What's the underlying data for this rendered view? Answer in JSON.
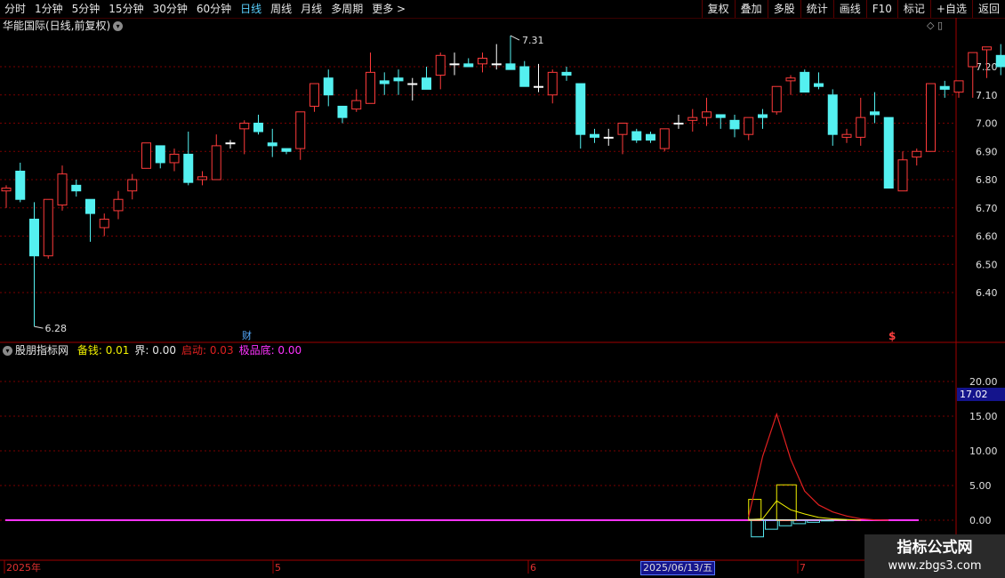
{
  "toolbar": {
    "left": [
      "分时",
      "1分钟",
      "5分钟",
      "15分钟",
      "30分钟",
      "60分钟",
      "日线",
      "周线",
      "月线",
      "多周期",
      "更多 >"
    ],
    "active_index": 6,
    "right": [
      "复权",
      "叠加",
      "多股",
      "统计",
      "画线",
      "F10",
      "标记",
      "+自选",
      "返回"
    ]
  },
  "stock": {
    "title": "华能国际(日线,前复权)"
  },
  "top_icons": "◇ ▯",
  "price_axis": {
    "labels": [
      "7.20",
      "7.10",
      "7.00",
      "6.90",
      "6.80",
      "6.70",
      "6.60",
      "6.50",
      "6.40"
    ],
    "values": [
      7.2,
      7.1,
      7.0,
      6.9,
      6.8,
      6.7,
      6.6,
      6.5,
      6.4
    ]
  },
  "annotations": {
    "high": "7.31",
    "low": "6.28",
    "cai": "财",
    "dollar": "$"
  },
  "candles": [
    [
      6.76,
      6.78,
      6.7,
      6.77
    ],
    [
      6.83,
      6.86,
      6.72,
      6.73
    ],
    [
      6.66,
      6.72,
      6.28,
      6.53
    ],
    [
      6.53,
      6.73,
      6.52,
      6.73
    ],
    [
      6.71,
      6.85,
      6.69,
      6.82
    ],
    [
      6.78,
      6.8,
      6.74,
      6.76
    ],
    [
      6.73,
      6.73,
      6.58,
      6.68
    ],
    [
      6.63,
      6.68,
      6.6,
      6.66
    ],
    [
      6.69,
      6.76,
      6.66,
      6.73
    ],
    [
      6.76,
      6.82,
      6.73,
      6.8
    ],
    [
      6.84,
      6.93,
      6.84,
      6.93
    ],
    [
      6.92,
      6.92,
      6.84,
      6.86
    ],
    [
      6.86,
      6.91,
      6.83,
      6.89
    ],
    [
      6.89,
      6.97,
      6.78,
      6.79
    ],
    [
      6.8,
      6.83,
      6.78,
      6.81
    ],
    [
      6.8,
      6.96,
      6.8,
      6.92
    ],
    [
      6.93,
      6.94,
      6.91,
      6.93
    ],
    [
      6.98,
      7.01,
      6.89,
      7.0
    ],
    [
      7.0,
      7.03,
      6.96,
      6.97
    ],
    [
      6.93,
      6.98,
      6.88,
      6.92
    ],
    [
      6.91,
      6.91,
      6.89,
      6.9
    ],
    [
      6.91,
      7.04,
      6.87,
      7.04
    ],
    [
      7.06,
      7.14,
      7.04,
      7.14
    ],
    [
      7.16,
      7.19,
      7.06,
      7.1
    ],
    [
      7.06,
      7.06,
      7.0,
      7.02
    ],
    [
      7.05,
      7.12,
      7.04,
      7.08
    ],
    [
      7.07,
      7.25,
      7.07,
      7.18
    ],
    [
      7.15,
      7.18,
      7.1,
      7.14
    ],
    [
      7.16,
      7.19,
      7.1,
      7.15
    ],
    [
      7.14,
      7.16,
      7.08,
      7.14
    ],
    [
      7.16,
      7.2,
      7.13,
      7.12
    ],
    [
      7.17,
      7.25,
      7.12,
      7.24
    ],
    [
      7.21,
      7.25,
      7.17,
      7.21
    ],
    [
      7.21,
      7.23,
      7.2,
      7.2
    ],
    [
      7.21,
      7.25,
      7.18,
      7.23
    ],
    [
      7.21,
      7.28,
      7.19,
      7.21
    ],
    [
      7.21,
      7.31,
      7.2,
      7.19
    ],
    [
      7.2,
      7.22,
      7.13,
      7.13
    ],
    [
      7.13,
      7.21,
      7.11,
      7.13
    ],
    [
      7.1,
      7.19,
      7.07,
      7.18
    ],
    [
      7.18,
      7.2,
      7.15,
      7.17
    ],
    [
      7.14,
      7.14,
      6.91,
      6.96
    ],
    [
      6.96,
      6.98,
      6.93,
      6.95
    ],
    [
      6.95,
      6.98,
      6.92,
      6.95
    ],
    [
      6.96,
      6.98,
      6.89,
      7.0
    ],
    [
      6.97,
      6.98,
      6.93,
      6.94
    ],
    [
      6.96,
      6.97,
      6.93,
      6.94
    ],
    [
      6.91,
      6.98,
      6.9,
      6.98
    ],
    [
      7.0,
      7.03,
      6.98,
      7.0
    ],
    [
      7.01,
      7.05,
      6.97,
      7.02
    ],
    [
      7.02,
      7.09,
      6.99,
      7.04
    ],
    [
      7.03,
      7.03,
      6.98,
      7.02
    ],
    [
      7.01,
      7.03,
      6.95,
      6.98
    ],
    [
      6.96,
      7.02,
      6.94,
      7.02
    ],
    [
      7.03,
      7.05,
      6.98,
      7.02
    ],
    [
      7.04,
      7.13,
      7.03,
      7.13
    ],
    [
      7.15,
      7.17,
      7.1,
      7.16
    ],
    [
      7.18,
      7.19,
      7.11,
      7.11
    ],
    [
      7.14,
      7.18,
      7.12,
      7.13
    ],
    [
      7.1,
      7.12,
      6.92,
      6.96
    ],
    [
      6.95,
      6.98,
      6.93,
      6.96
    ],
    [
      6.95,
      7.09,
      6.92,
      7.02
    ],
    [
      7.04,
      7.11,
      7.0,
      7.03
    ],
    [
      7.02,
      7.02,
      6.77,
      6.77
    ],
    [
      6.76,
      6.9,
      6.76,
      6.87
    ],
    [
      6.88,
      6.91,
      6.85,
      6.9
    ],
    [
      6.9,
      7.14,
      6.9,
      7.14
    ],
    [
      7.13,
      7.15,
      7.09,
      7.12
    ],
    [
      7.11,
      7.15,
      7.09,
      7.15
    ],
    [
      7.2,
      7.25,
      7.09,
      7.25
    ],
    [
      7.26,
      7.27,
      7.16,
      7.27
    ],
    [
      7.24,
      7.28,
      7.17,
      7.2
    ],
    [
      7.23,
      7.24,
      7.11,
      7.13
    ],
    [
      7.12,
      7.12,
      7.12,
      7.12
    ]
  ],
  "indicator": {
    "name": "股朋指标网",
    "items": [
      {
        "label": "备钱:",
        "value": "0.01",
        "color": "#f0f000"
      },
      {
        "label": "界:",
        "value": "0.00",
        "color": "#e8e8e8"
      },
      {
        "label": "启动:",
        "value": "0.03",
        "color": "#e02020"
      },
      {
        "label": "极品底:",
        "value": "0.00",
        "color": "#ff33ff"
      }
    ],
    "axis_labels": [
      "20.00",
      "15.00",
      "10.00",
      "5.00",
      "0.00"
    ],
    "axis_values": [
      20,
      15,
      10,
      5,
      0
    ],
    "cursor_value": "17.02",
    "red_line": [
      [
        53,
        0.5
      ],
      [
        54,
        9.2
      ],
      [
        55,
        15.3
      ],
      [
        56,
        8.8
      ],
      [
        57,
        4.2
      ],
      [
        58,
        2.2
      ],
      [
        59,
        1.2
      ],
      [
        60,
        0.6
      ],
      [
        61,
        0.2
      ],
      [
        62,
        0.05
      ],
      [
        63,
        0.0
      ]
    ],
    "yellow_line": [
      [
        53,
        0.1
      ],
      [
        54,
        0.2
      ],
      [
        55,
        2.8
      ],
      [
        56,
        1.5
      ],
      [
        57,
        0.9
      ],
      [
        58,
        0.4
      ],
      [
        59,
        0.2
      ],
      [
        60,
        0.1
      ],
      [
        61,
        0.0
      ]
    ],
    "yellow_bars": [
      [
        53,
        3.0
      ],
      [
        55,
        5.1
      ]
    ],
    "cyan_bars": [
      [
        53,
        -2.4
      ],
      [
        54,
        -1.3
      ],
      [
        55,
        -0.8
      ],
      [
        56,
        -0.5
      ],
      [
        57,
        -0.3
      ],
      [
        58,
        -0.1
      ]
    ]
  },
  "x_axis": {
    "labels": [
      "2025年",
      "5",
      "6",
      "7"
    ]
  },
  "date_box": "2025/06/13/五",
  "watermark": {
    "line1": "指标公式网",
    "line2": "www.zbgs3.com"
  }
}
